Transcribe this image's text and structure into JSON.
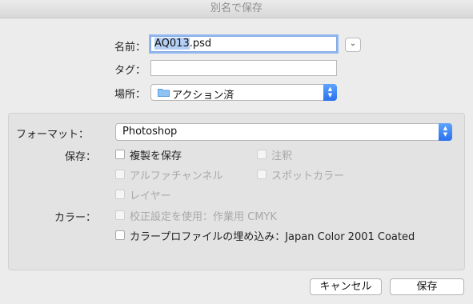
{
  "window": {
    "title": "別名で保存"
  },
  "name_field": {
    "label": "名前：",
    "value_selected": "AQ013",
    "value_rest": ".psd"
  },
  "tags_field": {
    "label": "タグ：",
    "value": ""
  },
  "location": {
    "label": "場所：",
    "folder": "アクション済",
    "icon": "folder-icon"
  },
  "format": {
    "label": "フォーマット：",
    "value": "Photoshop"
  },
  "save_options": {
    "label": "保存：",
    "copy": "複製を保存",
    "notes": "注釈",
    "alpha": "アルファチャンネル",
    "spot": "スポットカラー",
    "layers": "レイヤー"
  },
  "color_options": {
    "label": "カラー：",
    "proof": "校正設定を使用：作業用 CMYK",
    "icc": "カラープロファイルの埋め込み：Japan Color 2001 Coated"
  },
  "buttons": {
    "cancel": "キャンセル",
    "save": "保存"
  },
  "colors": {
    "accent": "#2a72ee",
    "focus_ring": "#94b9f0"
  }
}
